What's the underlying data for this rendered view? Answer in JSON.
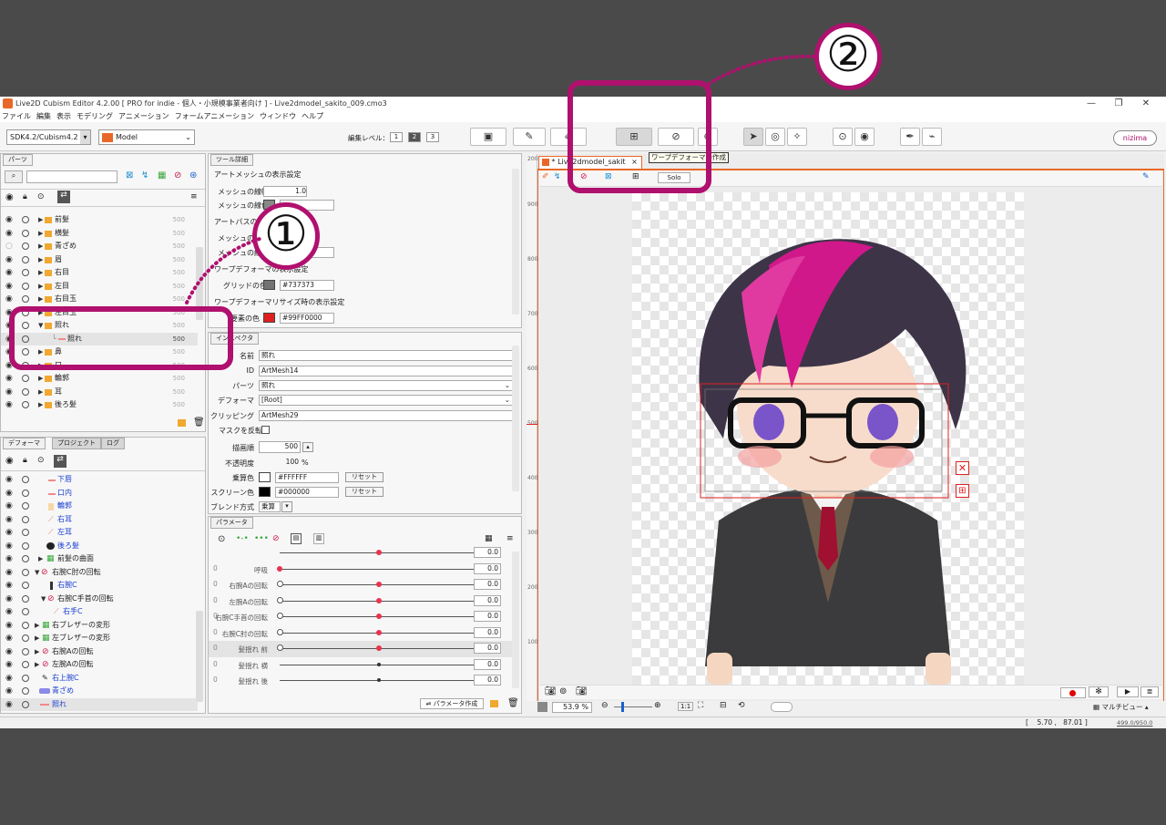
{
  "window": {
    "title": "Live2D Cubism Editor 4.2.00   [ PRO for indie - 個人・小規模事業者向け ] - Live2dmodel_sakito_009.cmo3",
    "min": "—",
    "max": "❐",
    "close": "✕"
  },
  "menu": [
    "ファイル",
    "編集",
    "表示",
    "モデリング",
    "アニメーション",
    "フォームアニメーション",
    "ウィンドウ",
    "ヘルプ"
  ],
  "toolbar": {
    "sdk_select": "SDK4.2/Cubism4.2",
    "model_select": "Model",
    "edit_level_label": "編集レベル：",
    "levels": [
      "1",
      "2",
      "3"
    ],
    "nizima": "nizima"
  },
  "parts_panel": {
    "tab": "パーツ",
    "rows": [
      {
        "name": "前髪",
        "num": "500"
      },
      {
        "name": "横髪",
        "num": "500"
      },
      {
        "name": "青ざめ",
        "num": "500"
      },
      {
        "name": "眉",
        "num": "500"
      },
      {
        "name": "右目",
        "num": "500"
      },
      {
        "name": "左目",
        "num": "500"
      },
      {
        "name": "右目玉",
        "num": "500"
      },
      {
        "name": "左目玉",
        "num": "500"
      },
      {
        "name": "照れ",
        "num": "500"
      },
      {
        "name": "照れ",
        "num": "500"
      },
      {
        "name": "鼻",
        "num": "500"
      },
      {
        "name": "口",
        "num": "500"
      },
      {
        "name": "輪郭",
        "num": "500"
      },
      {
        "name": "耳",
        "num": "500"
      },
      {
        "name": "後ろ髪",
        "num": "500"
      }
    ]
  },
  "deformer_panel": {
    "tabs": [
      "デフォーマ",
      "プロジェクト",
      "ログ"
    ],
    "rows": [
      "下唇",
      "口内",
      "輪郭",
      "右耳",
      "左耳",
      "後ろ髪",
      "前髪の曲面",
      "右腕C肘の回転",
      "右腕C",
      "右腕C手首の回転",
      "右手C",
      "右ブレザーの変形",
      "左ブレザーの変形",
      "右腕Aの回転",
      "左腕Aの回転",
      "右上腕C",
      "青ざめ",
      "照れ"
    ]
  },
  "tool_detail": {
    "tab": "ツール詳細",
    "mesh_section": "アートメッシュの表示設定",
    "mesh_width_label": "メッシュの線幅",
    "mesh_width_value": "1.0",
    "mesh_color_label": "メッシュの線色",
    "artpath_section": "アートパスの表示設定",
    "artpath_width_label": "メッシュの線幅",
    "artpath_color_label": "メッシュの線色",
    "warp_section": "ワープデフォーマの表示設定",
    "grid_color_label": "グリッドの色",
    "grid_color_value": "#737373",
    "warp_resize_section": "ワープデフォーマリサイズ時の表示設定",
    "elem_color_label": "要素の色",
    "elem_color_value": "#99FF0000"
  },
  "inspector": {
    "tab": "インスペクタ",
    "name_label": "名前",
    "name_value": "照れ",
    "id_label": "ID",
    "id_value": "ArtMesh14",
    "parts_label": "パーツ",
    "parts_value": "照れ",
    "deformer_label": "デフォーマ",
    "deformer_value": "[Root]",
    "clipping_label": "クリッピング",
    "clipping_value": "ArtMesh29",
    "invert_mask_label": "マスクを反転",
    "draw_order_label": "描画順",
    "draw_order_value": "500",
    "opacity_label": "不透明度",
    "opacity_value": "100",
    "opacity_unit": "%",
    "multiply_label": "乗算色",
    "multiply_value": "#FFFFFF",
    "screen_label": "スクリーン色",
    "screen_value": "#000000",
    "reset": "リセット",
    "blend_label": "ブレンド方式",
    "blend_value": "乗算"
  },
  "parameters": {
    "tab": "パラメータ",
    "rows": [
      {
        "name": "",
        "value": "0.0",
        "knob": 0.5,
        "style": "plain"
      },
      {
        "name": "呼吸",
        "value": "0.0",
        "knob": 0.0,
        "style": "plain"
      },
      {
        "name": "右腕Aの回転",
        "value": "0.0",
        "knob": 0.5,
        "style": "key"
      },
      {
        "name": "左腕Aの回転",
        "value": "0.0",
        "knob": 0.5,
        "style": "key"
      },
      {
        "name": "右腕C手首の回転",
        "value": "0.0",
        "knob": 0.5,
        "style": "key"
      },
      {
        "name": "右腕C肘の回転",
        "value": "0.0",
        "knob": 0.5,
        "style": "key"
      },
      {
        "name": "髪揺れ 前",
        "value": "0.0",
        "knob": 0.5,
        "style": "key"
      },
      {
        "name": "髪揺れ 横",
        "value": "0.0",
        "knob": 0.5,
        "style": "plain"
      },
      {
        "name": "髪揺れ 後",
        "value": "0.0",
        "knob": 0.5,
        "style": "plain"
      }
    ],
    "create_button": "パラメータ作成"
  },
  "viewport": {
    "tab": "* Live2dmodel_sakit",
    "solo": "Solo",
    "tooltip": "ワープデフォーマの作成",
    "ruler": [
      "2000",
      "900",
      "800",
      "700",
      "600",
      "500",
      "400",
      "300",
      "200",
      "100"
    ],
    "zoom": "53.9 %",
    "multiview": "マルチビュー",
    "coords": "[    5.70 ,   87.01 ]",
    "memory": "499.0/950.0"
  },
  "annotations": {
    "one": "①",
    "two": "②"
  },
  "colors": {
    "accent": "#b0106e",
    "selection": "#e8334f"
  }
}
